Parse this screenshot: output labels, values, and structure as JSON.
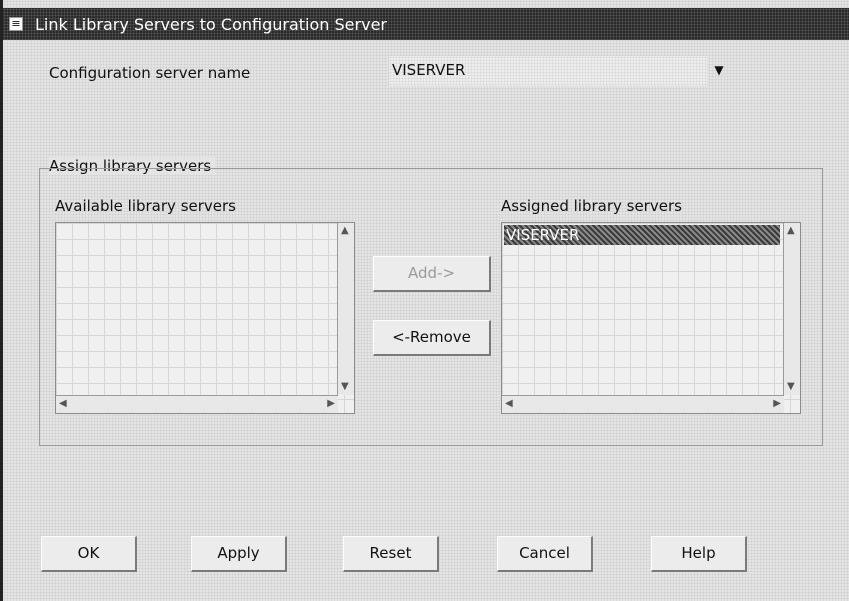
{
  "window": {
    "title": "Link Library Servers to Configuration Server",
    "system_menu_glyph": "≡"
  },
  "config": {
    "label": "Configuration server name",
    "value": "VISERVER"
  },
  "group": {
    "title": "Assign library servers",
    "available_label": "Available library servers",
    "assigned_label": "Assigned library servers",
    "available_items": [],
    "assigned_items": [
      "VISERVER"
    ]
  },
  "transfer": {
    "add_label": "Add->",
    "remove_label": "<-Remove"
  },
  "buttons": {
    "ok": "OK",
    "apply": "Apply",
    "reset": "Reset",
    "cancel": "Cancel",
    "help": "Help"
  }
}
